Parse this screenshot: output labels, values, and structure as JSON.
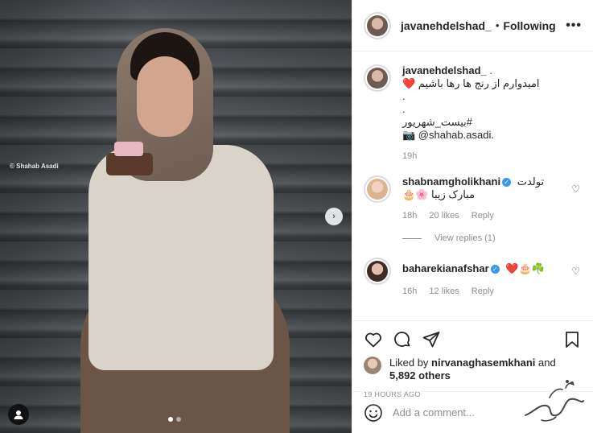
{
  "post": {
    "watermark": "Shahab Asadi",
    "slide_count": 2,
    "active_slide": 1
  },
  "header": {
    "username": "javanehdelshad_",
    "separator": "•",
    "follow_status": "Following",
    "more_icon": "more-dots-icon"
  },
  "caption": {
    "username": "javanehdelshad_",
    "suffix": ".",
    "lines": [
      "امیدوارم از رنج ها رها باشیم ❤️",
      ".",
      ".",
      "#بیست_شهریور",
      "📷 @shahab.asadi."
    ],
    "time": "19h"
  },
  "comments": [
    {
      "username": "shabnamgholikhani",
      "verified": true,
      "text_line1": "تولدت",
      "text_line2": "مبارک زیبا 🌸🎂",
      "time": "18h",
      "likes": "20 likes",
      "reply": "Reply",
      "view_replies": "View replies (1)"
    },
    {
      "username": "baharekianafshar",
      "verified": true,
      "text": "❤️🎂☘️",
      "time": "16h",
      "likes": "12 likes",
      "reply": "Reply"
    }
  ],
  "actions": {
    "like_icon": "heart-icon",
    "comment_icon": "comment-icon",
    "share_icon": "share-icon",
    "save_icon": "bookmark-icon"
  },
  "liked_by": {
    "prefix": "Liked by",
    "user": "nirvanaghasemkhani",
    "and": "and",
    "others": "5,892 others"
  },
  "timestamp": "19 HOURS AGO",
  "add_comment": {
    "placeholder": "Add a comment...",
    "emoji_icon": "emoji-icon"
  }
}
